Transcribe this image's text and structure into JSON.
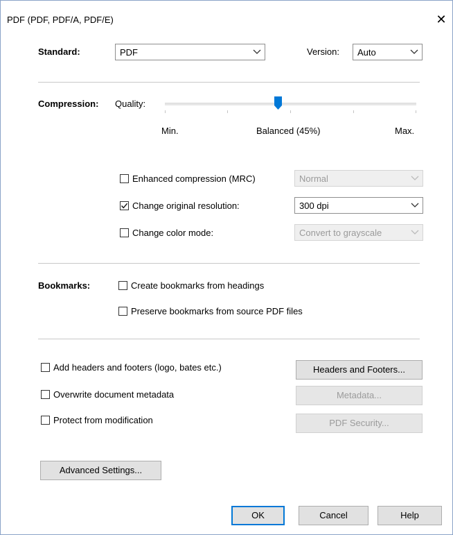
{
  "window": {
    "title": "PDF (PDF, PDF/A, PDF/E)"
  },
  "standard": {
    "label": "Standard:",
    "value": "PDF"
  },
  "version": {
    "label": "Version:",
    "value": "Auto"
  },
  "compression": {
    "label": "Compression:",
    "quality_label": "Quality:",
    "quality_percent": 45,
    "min_label": "Min.",
    "balanced_label": "Balanced (45%)",
    "max_label": "Max."
  },
  "options": {
    "enhanced": {
      "label": "Enhanced compression (MRC)",
      "checked": false,
      "combo_value": "Normal"
    },
    "resolution": {
      "label": "Change original resolution:",
      "checked": true,
      "combo_value": "300 dpi"
    },
    "color": {
      "label": "Change color mode:",
      "checked": false,
      "combo_value": "Convert to grayscale"
    }
  },
  "bookmarks": {
    "label": "Bookmarks:",
    "create": {
      "label": "Create bookmarks from headings",
      "checked": false
    },
    "preserve": {
      "label": "Preserve bookmarks from source PDF files",
      "checked": false
    }
  },
  "misc": {
    "headers": {
      "label": "Add headers and footers (logo, bates etc.)",
      "checked": false,
      "button": "Headers and Footers..."
    },
    "metadata": {
      "label": "Overwrite document metadata",
      "checked": false,
      "button": "Metadata..."
    },
    "protect": {
      "label": "Protect from modification",
      "checked": false,
      "button": "PDF Security..."
    }
  },
  "advanced_button": "Advanced Settings...",
  "footer": {
    "ok": "OK",
    "cancel": "Cancel",
    "help": "Help"
  },
  "colors": {
    "accent": "#0078d7",
    "separator": "#c8c8c8",
    "disabled_text": "#9a9a9a",
    "button_face": "#e1e1e1"
  }
}
